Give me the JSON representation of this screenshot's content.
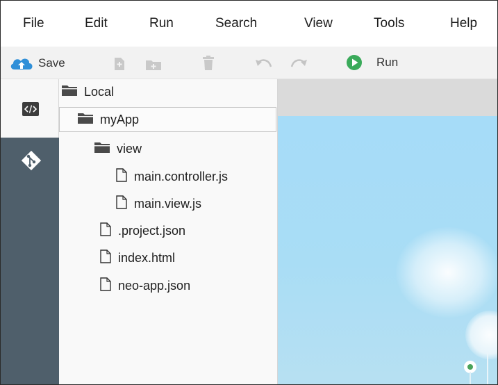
{
  "menu": {
    "items": [
      {
        "label": "File"
      },
      {
        "label": "Edit"
      },
      {
        "label": "Run"
      },
      {
        "label": "Search"
      },
      {
        "label": "View"
      },
      {
        "label": "Tools"
      },
      {
        "label": "Help"
      }
    ]
  },
  "toolbar": {
    "save_label": "Save",
    "run_label": "Run",
    "icons": [
      "cloud-upload-icon",
      "new-file-icon",
      "new-folder-icon",
      "delete-icon",
      "undo-icon",
      "redo-icon",
      "play-icon"
    ],
    "run_color": "#3aaa5a",
    "save_color": "#2f8fd8"
  },
  "rail": {
    "icons": [
      "code-icon",
      "git-icon"
    ],
    "color": "#4f5f6b"
  },
  "tree": {
    "root": "Local",
    "project": "myApp",
    "folder": "view",
    "files_in_view": [
      "main.controller.js",
      "main.view.js"
    ],
    "project_files": [
      ".project.json",
      "index.html",
      "neo-app.json"
    ]
  }
}
